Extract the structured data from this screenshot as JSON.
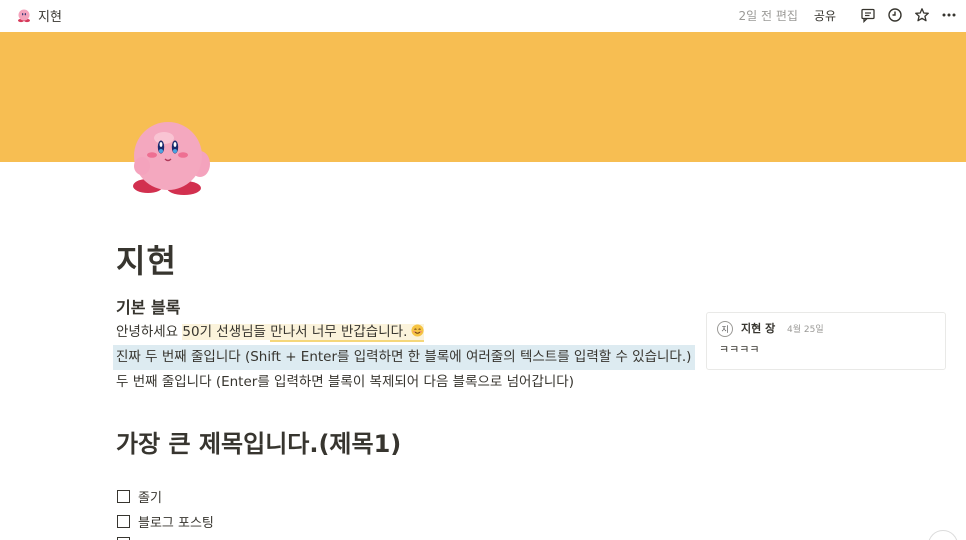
{
  "topbar": {
    "page_title": "지현",
    "edited": "2일 전 편집",
    "share": "공유"
  },
  "page": {
    "title": "지현",
    "cover_color": "#f7be52",
    "icon": "kirby-character"
  },
  "blocks": {
    "heading3": "기본 블록",
    "line1_prefix": "안녕하세요 ",
    "line1_hl": "50기 선생님들 ",
    "line1_ul": "만나서 너무 반갑습니다.",
    "line2": "진짜 두 번째 줄입니다 (Shift + Enter를 입력하면 한 블록에 여러줄의 텍스트를 입력할 수 있습니다.)",
    "line3": "두 번째 줄입니다 (Enter를 입력하면 블록이 복제되어 다음 블록으로 넘어갑니다)",
    "heading1": "가장 큰 제목입니다.(제목1)"
  },
  "todos": [
    {
      "label": "졸기",
      "checked": false
    },
    {
      "label": "블로그 포스팅",
      "checked": false
    }
  ],
  "comment": {
    "avatar": "지",
    "author": "지현 장",
    "date": "4월 25일",
    "text": "ㅋㅋㅋㅋ"
  }
}
